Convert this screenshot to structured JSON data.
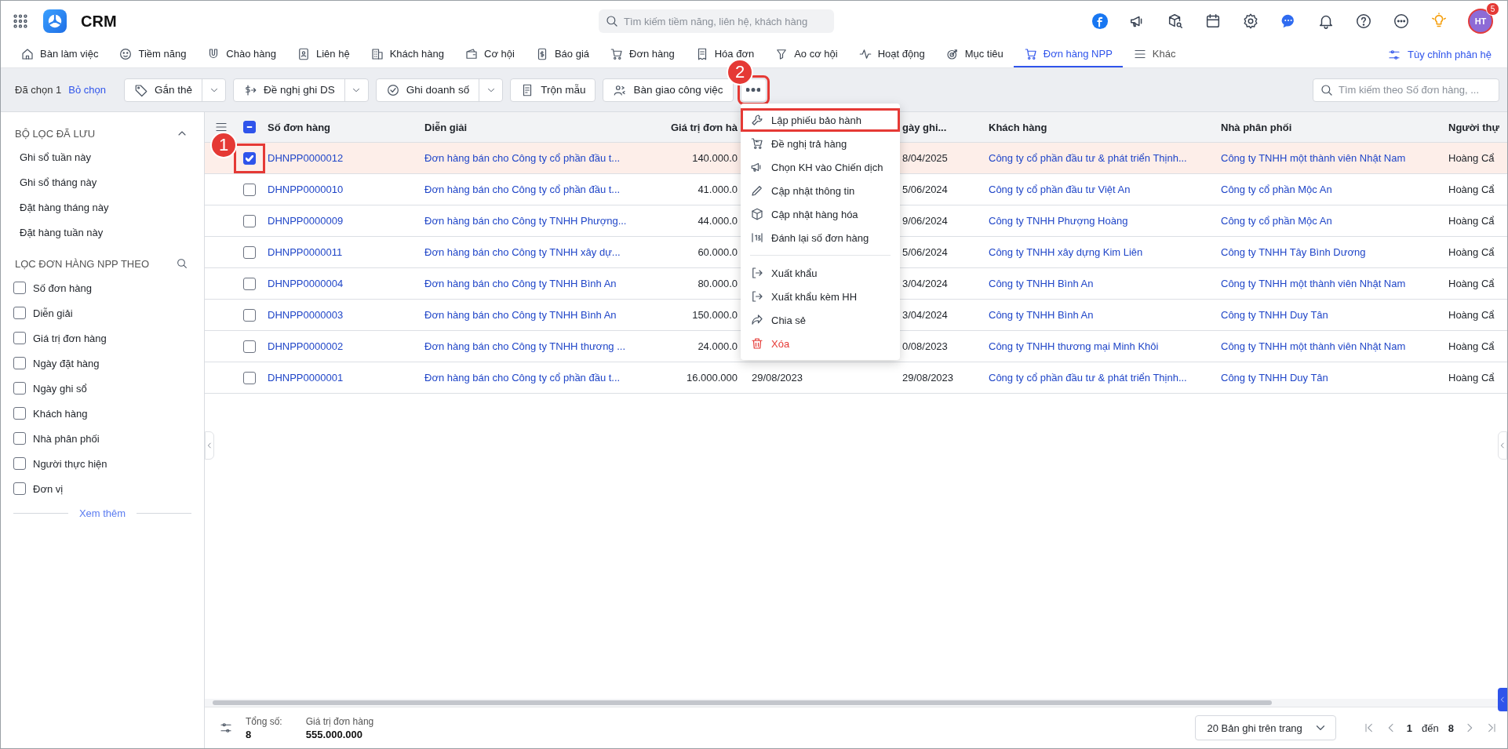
{
  "app": {
    "title": "CRM"
  },
  "search": {
    "placeholder": "Tìm kiếm tiềm năng, liên hệ, khách hàng"
  },
  "avatar": {
    "initials": "HT",
    "badge": "5"
  },
  "nav": {
    "tabs": [
      {
        "label": "Bàn làm việc",
        "selected": false
      },
      {
        "label": "Tiềm năng",
        "selected": false
      },
      {
        "label": "Chào hàng",
        "selected": false
      },
      {
        "label": "Liên hệ",
        "selected": false
      },
      {
        "label": "Khách hàng",
        "selected": false
      },
      {
        "label": "Cơ hội",
        "selected": false
      },
      {
        "label": "Báo giá",
        "selected": false
      },
      {
        "label": "Đơn hàng",
        "selected": false
      },
      {
        "label": "Hóa đơn",
        "selected": false
      },
      {
        "label": "Ao cơ hội",
        "selected": false
      },
      {
        "label": "Hoạt động",
        "selected": false
      },
      {
        "label": "Mục tiêu",
        "selected": false
      },
      {
        "label": "Đơn hàng NPP",
        "selected": true
      },
      {
        "label": "Khác",
        "selected": false
      }
    ],
    "customize": "Tùy chỉnh phân hệ"
  },
  "toolbar": {
    "selected_count": "Đã chọn 1",
    "clear": "Bỏ chọn",
    "buttons": [
      {
        "label": "Gắn thẻ",
        "kind": "split",
        "highlighted": false
      },
      {
        "label": "Đề nghị ghi DS",
        "kind": "split",
        "highlighted": false
      },
      {
        "label": "Ghi doanh số",
        "kind": "split",
        "highlighted": false
      },
      {
        "label": "Trộn mẫu",
        "kind": "plain",
        "highlighted": false
      },
      {
        "label": "Bàn giao công việc",
        "kind": "plain",
        "highlighted": false
      },
      {
        "kind": "more",
        "highlighted": true
      }
    ],
    "search": {
      "placeholder": "Tìm kiếm theo Số đơn hàng, ..."
    }
  },
  "sidebar": {
    "saved_filters": {
      "title": "BỘ LỌC ĐÃ LƯU",
      "expanded": true,
      "items": [
        "Ghi sổ tuần này",
        "Ghi sổ tháng này",
        "Đặt hàng tháng này",
        "Đặt hàng tuần này"
      ]
    },
    "filter_by": {
      "title": "LỌC ĐƠN HÀNG NPP THEO",
      "fields": [
        {
          "label": "Số đơn hàng",
          "checked": false
        },
        {
          "label": "Diễn giải",
          "checked": false
        },
        {
          "label": "Giá trị đơn hàng",
          "checked": false
        },
        {
          "label": "Ngày đặt hàng",
          "checked": false
        },
        {
          "label": "Ngày ghi sổ",
          "checked": false
        },
        {
          "label": "Khách hàng",
          "checked": false
        },
        {
          "label": "Nhà phân phối",
          "checked": false
        },
        {
          "label": "Người thực hiện",
          "checked": false
        },
        {
          "label": "Đơn vị",
          "checked": false
        }
      ]
    },
    "more_link": "Xem thêm"
  },
  "table": {
    "select_all_indeterminate": true,
    "columns": [
      {
        "label": "Số đơn hàng"
      },
      {
        "label": "Diễn giải"
      },
      {
        "label": "Giá trị đơn hà"
      },
      {},
      {
        "label": "gày ghi..."
      },
      {
        "label": "Khách hàng"
      },
      {
        "label": "Nhà phân phối"
      },
      {
        "label": "Người thự"
      }
    ],
    "rows": [
      {
        "selected": true,
        "highlighted": true,
        "order_no": "DHNPP0000012",
        "description": "Đơn hàng bán cho Công ty cổ phần đầu t...",
        "value": "140.000.0",
        "posting_date": "8/04/2025",
        "customer": "Công ty cổ phần đầu tư & phát triển Thịnh...",
        "distributor": "Công ty TNHH một thành viên Nhật Nam",
        "performer": "Hoàng Cẩ"
      },
      {
        "selected": false,
        "order_no": "DHNPP0000010",
        "description": "Đơn hàng bán cho Công ty cổ phần đầu t...",
        "value": "41.000.0",
        "posting_date": "5/06/2024",
        "customer": "Công ty cổ phần đầu tư Việt An",
        "distributor": "Công ty cổ phần Mộc An",
        "performer": "Hoàng Cẩ"
      },
      {
        "selected": false,
        "order_no": "DHNPP0000009",
        "description": "Đơn hàng bán cho Công ty TNHH Phượng...",
        "value": "44.000.0",
        "posting_date": "9/06/2024",
        "customer": "Công ty TNHH Phượng Hoàng",
        "distributor": "Công ty cổ phần Mộc An",
        "performer": "Hoàng Cẩ"
      },
      {
        "selected": false,
        "order_no": "DHNPP0000011",
        "description": "Đơn hàng bán cho Công ty TNHH xây dự...",
        "value": "60.000.0",
        "posting_date": "5/06/2024",
        "customer": "Công ty TNHH xây dựng Kim Liên",
        "distributor": "Công ty TNHH Tây Bình Dương",
        "performer": "Hoàng Cẩ"
      },
      {
        "selected": false,
        "order_no": "DHNPP0000004",
        "description": "Đơn hàng bán cho Công ty TNHH Bình An",
        "value": "80.000.0",
        "posting_date": "3/04/2024",
        "customer": "Công ty TNHH Bình An",
        "distributor": "Công ty TNHH một thành viên Nhật Nam",
        "performer": "Hoàng Cẩ"
      },
      {
        "selected": false,
        "order_no": "DHNPP0000003",
        "description": "Đơn hàng bán cho Công ty TNHH Bình An",
        "value": "150.000.0",
        "posting_date": "3/04/2024",
        "customer": "Công ty TNHH Bình An",
        "distributor": "Công ty TNHH Duy Tân",
        "performer": "Hoàng Cẩ"
      },
      {
        "selected": false,
        "order_no": "DHNPP0000002",
        "description": "Đơn hàng bán cho Công ty TNHH thương ...",
        "value": "24.000.0",
        "posting_date": "0/08/2023",
        "customer": "Công ty TNHH thương mại Minh Khôi",
        "distributor": "Công ty TNHH một thành viên Nhật Nam",
        "performer": "Hoàng Cẩ"
      },
      {
        "selected": false,
        "order_no": "DHNPP0000001",
        "description": "Đơn hàng bán cho Công ty cổ phần đầu t...",
        "value": "16.000.000",
        "order_date": "29/08/2023",
        "posting_date": "29/08/2023",
        "customer": "Công ty cổ phần đầu tư & phát triển Thịnh...",
        "distributor": "Công ty TNHH Duy Tân",
        "performer": "Hoàng Cẩ"
      }
    ]
  },
  "menu": {
    "items": [
      {
        "kind": "action",
        "label": "Lập phiếu bảo hành",
        "highlighted": true
      },
      {
        "kind": "action",
        "label": "Đề nghị trả hàng",
        "highlighted": false
      },
      {
        "kind": "action",
        "label": "Chọn KH vào Chiến dịch",
        "highlighted": false
      },
      {
        "kind": "action",
        "label": "Cập nhật thông tin",
        "highlighted": false
      },
      {
        "kind": "action",
        "label": "Cập nhật hàng hóa",
        "highlighted": false
      },
      {
        "kind": "action",
        "label": "Đánh lại số đơn hàng",
        "highlighted": false
      },
      {
        "kind": "divider"
      },
      {
        "kind": "action",
        "label": "Xuất khẩu",
        "highlighted": false
      },
      {
        "kind": "action",
        "label": "Xuất khẩu kèm HH",
        "highlighted": false
      },
      {
        "kind": "action",
        "label": "Chia sẻ",
        "highlighted": false
      },
      {
        "kind": "danger",
        "label": "Xóa",
        "highlighted": false
      }
    ]
  },
  "footer": {
    "total_label": "Tổng số:",
    "total": "8",
    "value_label": "Giá trị đơn hàng",
    "value": "555.000.000",
    "page_size": "20 Bản ghi trên trang",
    "page": "1",
    "page_sep": "đến",
    "page_total": "8"
  },
  "annotations": [
    {
      "label": "1"
    },
    {
      "label": "2"
    }
  ]
}
